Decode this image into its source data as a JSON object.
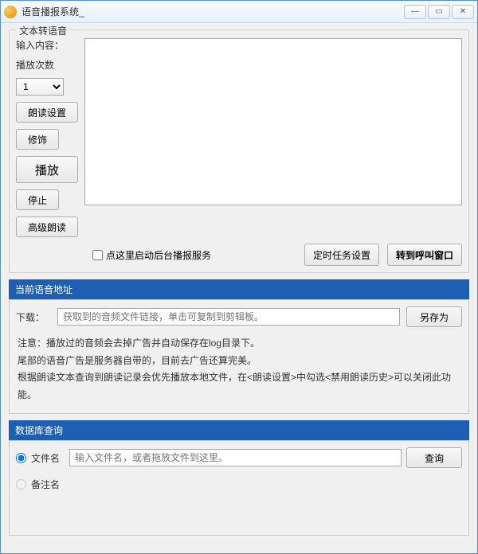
{
  "window": {
    "title": "语音播报系统_"
  },
  "tts": {
    "legend": "文本转语音",
    "input_label": "输入内容：",
    "play_count_label": "播放次数",
    "play_count_value": "1",
    "btn_read_settings": "朗读设置",
    "btn_decorate": "修饰",
    "btn_play": "播放",
    "btn_stop": "停止",
    "btn_advanced": "高级朗读",
    "checkbox_label": "点这里启动后台播报服务",
    "btn_timer": "定时任务设置",
    "btn_switch": "转到呼叫窗口"
  },
  "voice_url": {
    "header": "当前语音地址",
    "download_label": "下载：",
    "download_placeholder": "获取到的音频文件链接，单击可复制到剪辑板。",
    "btn_save_as": "另存为",
    "note1": "注意：播放过的音频会去掉广告并自动保存在log目录下。",
    "note2": "尾部的语音广告是服务器自带的，目前去广告还算完美。",
    "note3": "根据朗读文本查询到朗读记录会优先播放本地文件，在<朗读设置>中勾选<禁用朗读历史>可以关闭此功能。"
  },
  "db_query": {
    "header": "数据库查询",
    "radio_filename": "文件名",
    "filename_placeholder": "输入文件名，或者拖放文件到这里。",
    "btn_query": "查询",
    "radio_remark": "备注名"
  }
}
